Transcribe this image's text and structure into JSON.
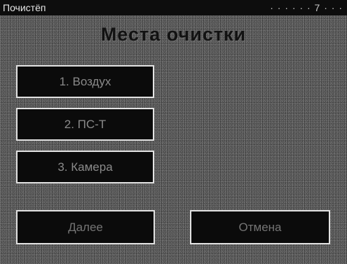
{
  "status_bar": {
    "left_text": "Почистёп",
    "right_text": "· · · · · · 7 · · ·"
  },
  "page": {
    "title": "Места очистки"
  },
  "menu": {
    "items": [
      {
        "label": "1. Воздух"
      },
      {
        "label": "2. ПС-Т"
      },
      {
        "label": "3. Камера"
      }
    ]
  },
  "footer": {
    "back_label": "Далее",
    "next_label": "Отмена"
  }
}
